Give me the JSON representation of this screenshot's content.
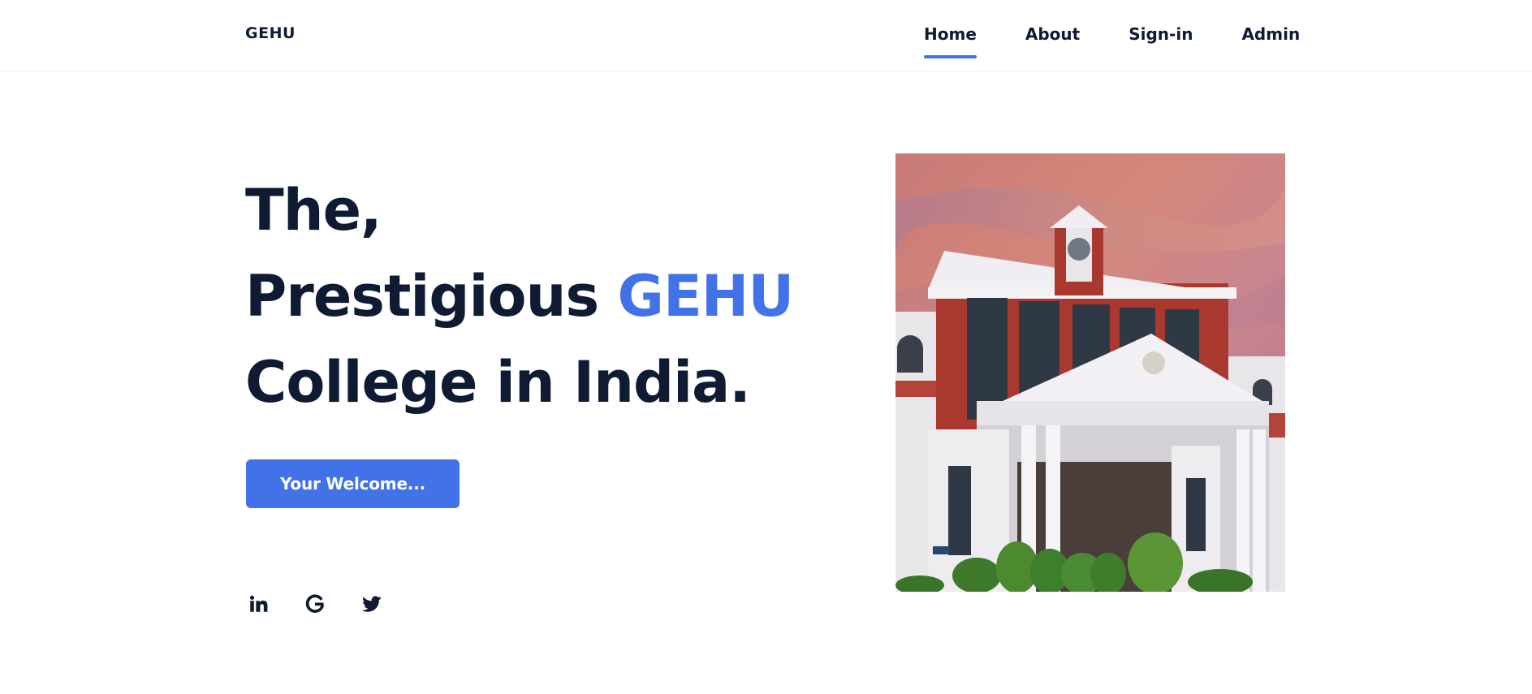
{
  "brand": "GEHU",
  "nav": {
    "items": [
      {
        "label": "Home",
        "active": true
      },
      {
        "label": "About",
        "active": false
      },
      {
        "label": "Sign-in",
        "active": false
      },
      {
        "label": "Admin",
        "active": false
      }
    ]
  },
  "hero": {
    "line1": "The,",
    "line2_prefix": "Prestigious ",
    "line2_accent": "GEHU",
    "line3": "College in India.",
    "cta_label": "Your Welcome..."
  },
  "socials": [
    "linkedin-icon",
    "google-icon",
    "twitter-icon"
  ],
  "colors": {
    "accent": "#4272e8",
    "text": "#0f1a33"
  }
}
